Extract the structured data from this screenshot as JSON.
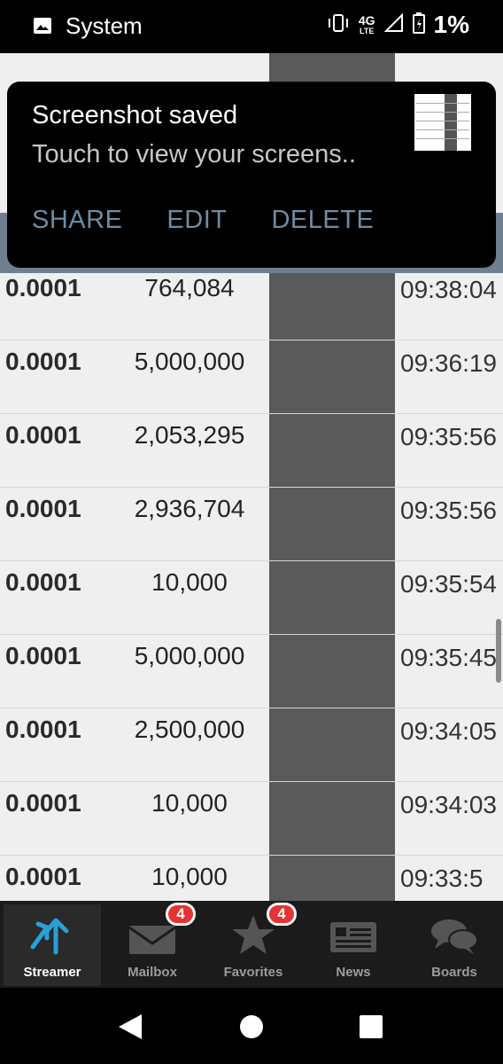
{
  "status_bar": {
    "app_name": "System",
    "network_top": "4G",
    "network_bottom": "LTE",
    "battery": "1%"
  },
  "notification": {
    "title": "Screenshot saved",
    "text": "Touch to view your screens..",
    "actions": [
      "SHARE",
      "EDIT",
      "DELETE"
    ]
  },
  "trades": [
    {
      "price": "0.0001",
      "volume": "764,084",
      "time": "09:38:04"
    },
    {
      "price": "0.0001",
      "volume": "5,000,000",
      "time": "09:36:19"
    },
    {
      "price": "0.0001",
      "volume": "2,053,295",
      "time": "09:35:56"
    },
    {
      "price": "0.0001",
      "volume": "2,936,704",
      "time": "09:35:56"
    },
    {
      "price": "0.0001",
      "volume": "10,000",
      "time": "09:35:54"
    },
    {
      "price": "0.0001",
      "volume": "5,000,000",
      "time": "09:35:45"
    },
    {
      "price": "0.0001",
      "volume": "2,500,000",
      "time": "09:34:05"
    },
    {
      "price": "0.0001",
      "volume": "10,000",
      "time": "09:34:03"
    },
    {
      "price": "0.0001",
      "volume": "10,000",
      "time": "09:33:5"
    }
  ],
  "tabs": [
    {
      "label": "Streamer",
      "icon": "streamer-arrows-icon",
      "active": true
    },
    {
      "label": "Mailbox",
      "icon": "mail-icon",
      "badge": "4"
    },
    {
      "label": "Favorites",
      "icon": "star-icon",
      "badge": "4"
    },
    {
      "label": "News",
      "icon": "news-icon"
    },
    {
      "label": "Boards",
      "icon": "chat-bubbles-icon"
    }
  ],
  "colors": {
    "accent": "#2a9fd8",
    "badge": "#e33333",
    "notification_action": "#6f8ca3"
  }
}
